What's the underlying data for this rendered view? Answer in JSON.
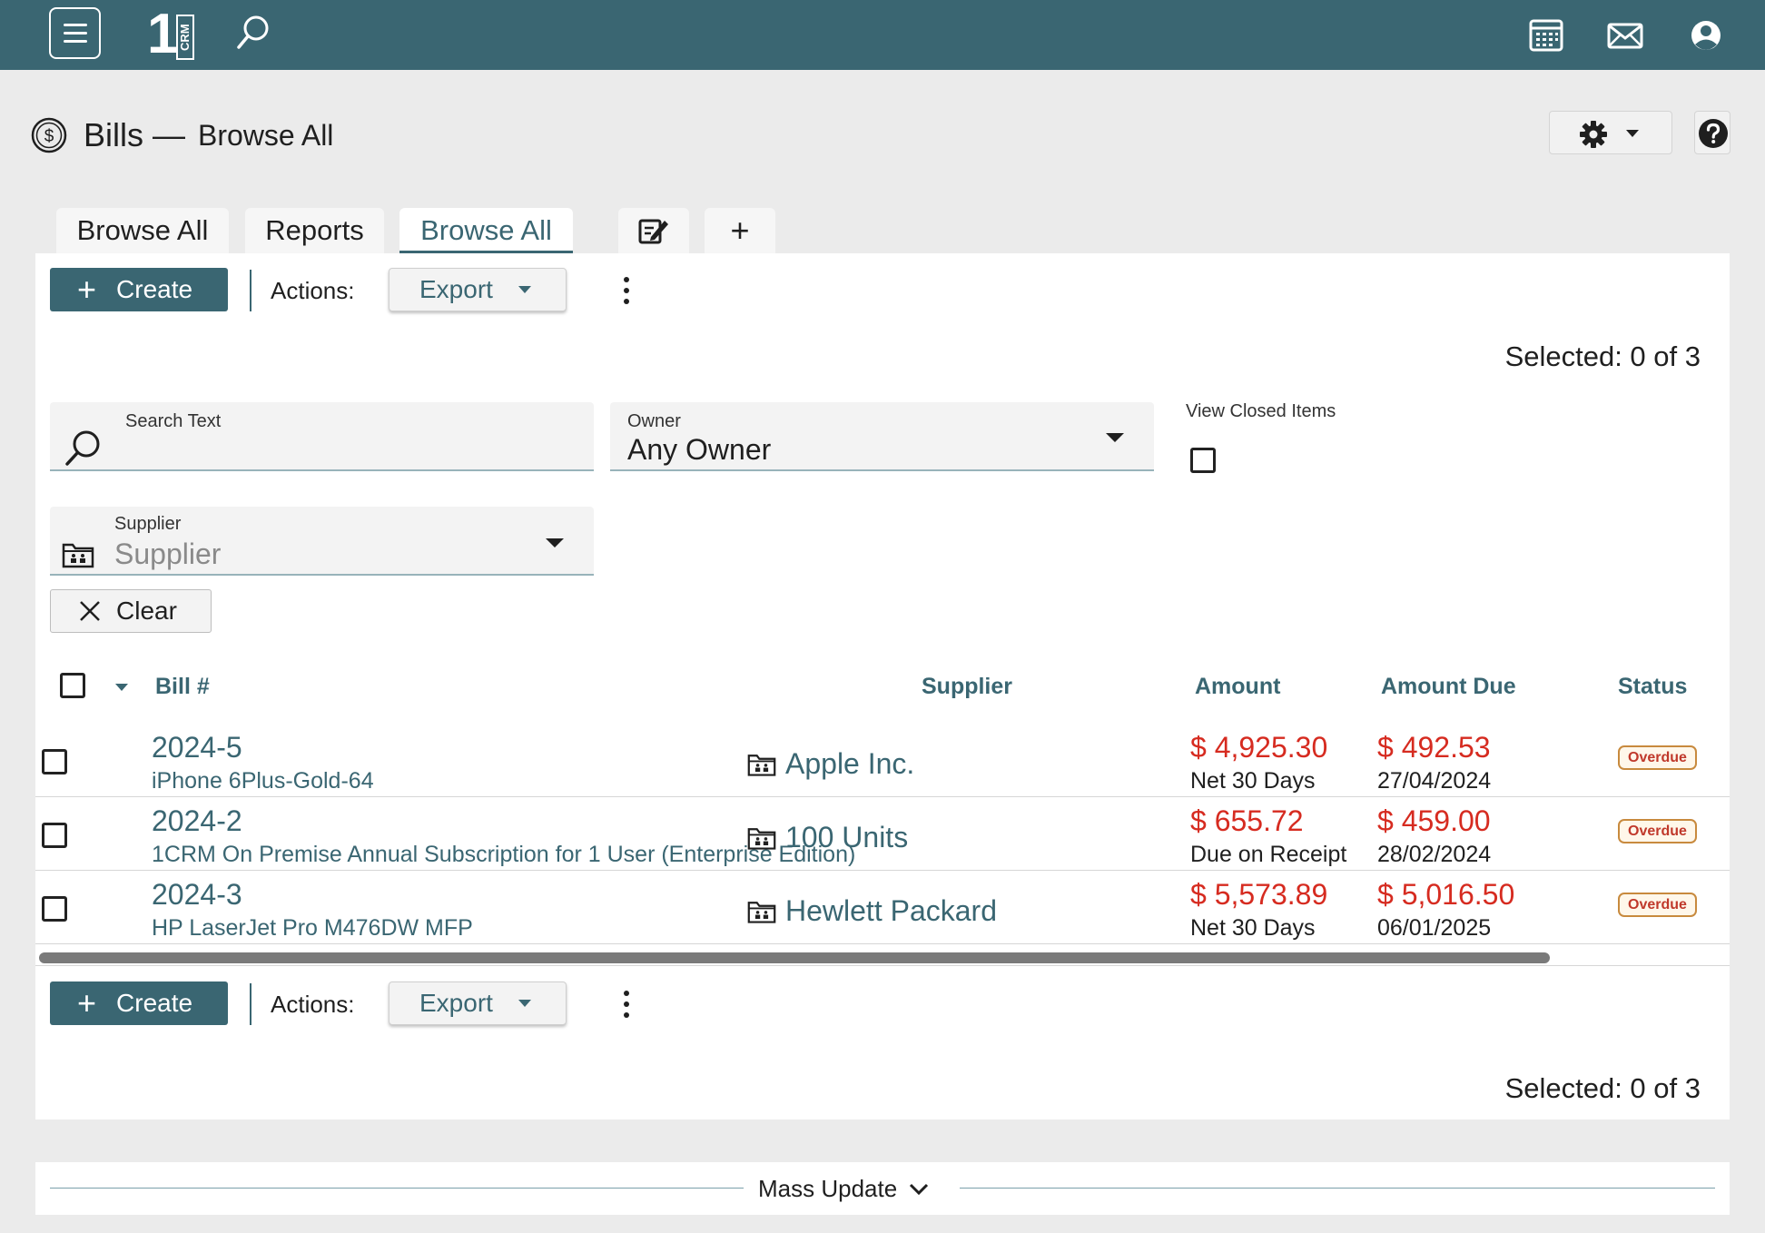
{
  "topbar": {
    "logo_number": "1",
    "logo_text": "CRM",
    "icons": [
      "menu-icon",
      "search-icon",
      "calendar-icon",
      "mail-icon",
      "user-icon"
    ]
  },
  "header": {
    "title": "Bills",
    "separator": "—",
    "subtitle": "Browse All"
  },
  "tabs": [
    {
      "label": "Browse All",
      "active": false
    },
    {
      "label": "Reports",
      "active": false
    },
    {
      "label": "Browse All",
      "active": true
    },
    {
      "label": "",
      "icon": "edit-icon"
    },
    {
      "label": "+",
      "icon": "plus-icon"
    }
  ],
  "toolbar": {
    "create_label": "Create",
    "actions_label": "Actions:",
    "export_label": "Export",
    "selected_text": "Selected: 0 of 3"
  },
  "filters": {
    "search_label": "Search Text",
    "search_value": "",
    "owner_label": "Owner",
    "owner_value": "Any Owner",
    "view_closed_label": "View Closed Items",
    "view_closed_checked": false,
    "supplier_label": "Supplier",
    "supplier_placeholder": "Supplier",
    "clear_label": "Clear"
  },
  "table": {
    "columns": [
      "Bill #",
      "Supplier",
      "Amount",
      "Amount Due",
      "Status"
    ],
    "rows": [
      {
        "bill_no": "2024-5",
        "description": "iPhone 6Plus-Gold-64",
        "supplier": "Apple Inc.",
        "amount": "$ 4,925.30",
        "terms": "Net 30 Days",
        "amount_due": "$ 492.53",
        "due_date": "27/04/2024",
        "status": "Overdue"
      },
      {
        "bill_no": "2024-2",
        "description": "1CRM On Premise Annual Subscription for 1 User (Enterprise Edition)",
        "supplier": "100 Units",
        "amount": "$ 655.72",
        "terms": "Due on Receipt",
        "amount_due": "$ 459.00",
        "due_date": "28/02/2024",
        "status": "Overdue"
      },
      {
        "bill_no": "2024-3",
        "description": "HP LaserJet Pro M476DW MFP",
        "supplier": "Hewlett Packard",
        "amount": "$ 5,573.89",
        "terms": "Net 30 Days",
        "amount_due": "$ 5,016.50",
        "due_date": "06/01/2025",
        "status": "Overdue"
      }
    ]
  },
  "footer": {
    "mass_update_label": "Mass Update"
  },
  "colors": {
    "brand": "#3a6672",
    "amount_red": "#d62b20",
    "badge_border": "#c88a3e"
  }
}
